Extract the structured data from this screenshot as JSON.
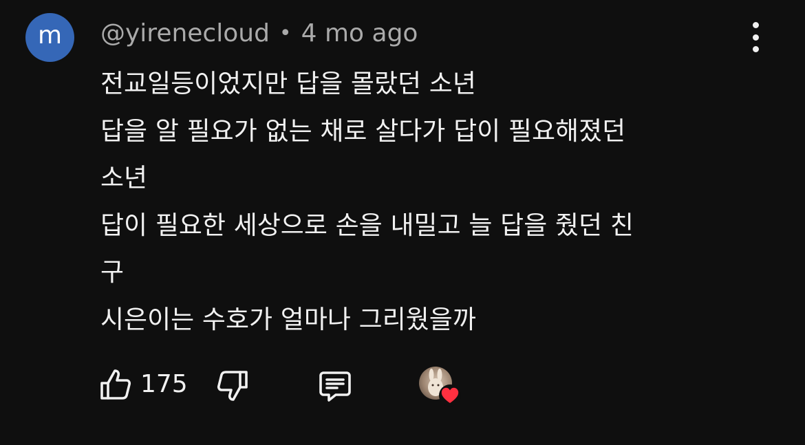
{
  "comment": {
    "avatar_letter": "m",
    "author": "@yirenecloud",
    "separator": "•",
    "time": "4 mo ago",
    "lines": [
      "전교일등이었지만 답을 몰랐던 소년",
      "답을 알 필요가 없는 채로 살다가 답이 필요해졌던",
      "소년",
      "답이 필요한 세상으로 손을 내밀고 늘 답을 줬던 친",
      "구",
      "시은이는 수호가 얼마나 그리웠을까"
    ]
  },
  "actions": {
    "like_count": "175",
    "icons": {
      "like": "thumbs-up-icon",
      "dislike": "thumbs-down-icon",
      "reply": "reply-comment-icon",
      "more": "more-vertical-icon",
      "creator_heart": "heart-icon"
    }
  },
  "colors": {
    "background": "#0f0f0f",
    "avatar": "#3567b7",
    "text": "#f1f1f1",
    "meta": "#aaaaaa",
    "heart": "#ff3040"
  }
}
